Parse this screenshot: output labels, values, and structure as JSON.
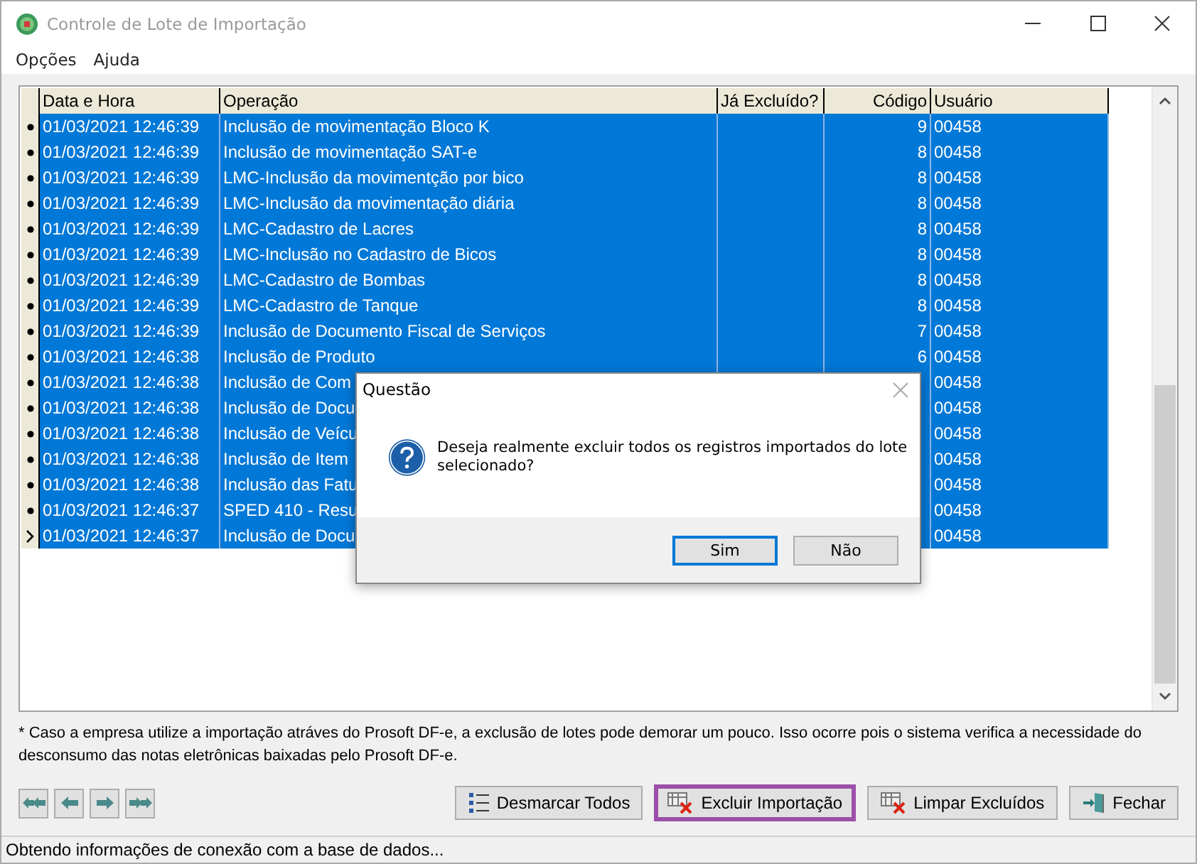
{
  "window": {
    "title": "Controle de Lote de Importação"
  },
  "menu": [
    "Opções",
    "Ajuda"
  ],
  "table": {
    "columns": [
      "Data e Hora",
      "Operação",
      "Já Excluído?",
      "Código",
      "Usuário"
    ],
    "rows": [
      {
        "current": false,
        "selected": true,
        "cells": [
          "01/03/2021 12:46:39",
          "Inclusão de movimentação Bloco K",
          "",
          "9",
          "00458"
        ]
      },
      {
        "current": false,
        "selected": true,
        "cells": [
          "01/03/2021 12:46:39",
          "Inclusão de movimentação SAT-e",
          "",
          "8",
          "00458"
        ]
      },
      {
        "current": false,
        "selected": true,
        "cells": [
          "01/03/2021 12:46:39",
          "LMC-Inclusão da movimentção por bico",
          "",
          "8",
          "00458"
        ]
      },
      {
        "current": false,
        "selected": true,
        "cells": [
          "01/03/2021 12:46:39",
          "LMC-Inclusão da movimentação diária",
          "",
          "8",
          "00458"
        ]
      },
      {
        "current": false,
        "selected": true,
        "cells": [
          "01/03/2021 12:46:39",
          "LMC-Cadastro de Lacres",
          "",
          "8",
          "00458"
        ]
      },
      {
        "current": false,
        "selected": true,
        "cells": [
          "01/03/2021 12:46:39",
          "LMC-Inclusão no Cadastro de Bicos",
          "",
          "8",
          "00458"
        ]
      },
      {
        "current": false,
        "selected": true,
        "cells": [
          "01/03/2021 12:46:39",
          "LMC-Cadastro de Bombas",
          "",
          "8",
          "00458"
        ]
      },
      {
        "current": false,
        "selected": true,
        "cells": [
          "01/03/2021 12:46:39",
          "LMC-Cadastro de Tanque",
          "",
          "8",
          "00458"
        ]
      },
      {
        "current": false,
        "selected": true,
        "cells": [
          "01/03/2021 12:46:39",
          "Inclusão de Documento Fiscal de Serviços",
          "",
          "7",
          "00458"
        ]
      },
      {
        "current": false,
        "selected": true,
        "cells": [
          "01/03/2021 12:46:38",
          "Inclusão de Produto",
          "",
          "6",
          "00458"
        ]
      },
      {
        "current": false,
        "selected": true,
        "cells": [
          "01/03/2021 12:46:38",
          "Inclusão de Com",
          "",
          "",
          "00458"
        ]
      },
      {
        "current": false,
        "selected": true,
        "cells": [
          "01/03/2021 12:46:38",
          "Inclusão de Docu",
          "",
          "",
          "00458"
        ]
      },
      {
        "current": false,
        "selected": true,
        "cells": [
          "01/03/2021 12:46:38",
          "Inclusão de Veícu",
          "",
          "",
          "00458"
        ]
      },
      {
        "current": false,
        "selected": true,
        "cells": [
          "01/03/2021 12:46:38",
          "Inclusão de Item",
          "",
          "",
          "00458"
        ]
      },
      {
        "current": false,
        "selected": true,
        "cells": [
          "01/03/2021 12:46:38",
          "Inclusão das Fatu",
          "",
          "",
          "00458"
        ]
      },
      {
        "current": false,
        "selected": true,
        "cells": [
          "01/03/2021 12:46:37",
          "SPED 410 - Resu",
          "",
          "",
          "00458"
        ]
      },
      {
        "current": true,
        "selected": true,
        "cells": [
          "01/03/2021 12:46:37",
          "Inclusão de Docu",
          "",
          "",
          "00458"
        ]
      }
    ]
  },
  "note": "* Caso a empresa utilize a importação atráves do Prosoft DF-e, a exclusão de lotes pode demorar um pouco. Isso ocorre pois o sistema verifica a necessidade do desconsumo das notas eletrônicas baixadas pelo  Prosoft DF-e.",
  "navigation": [
    {
      "kind": "first"
    },
    {
      "kind": "previous"
    },
    {
      "kind": "next"
    },
    {
      "kind": "last"
    }
  ],
  "buttons": [
    {
      "kind": "list",
      "label": "Desmarcar Todos",
      "focused": false
    },
    {
      "kind": "delete",
      "label": "Excluir Importação",
      "focused": true
    },
    {
      "kind": "delete",
      "label": "Limpar Excluídos",
      "focused": false
    },
    {
      "kind": "exit",
      "label": "Fechar",
      "focused": false
    }
  ],
  "status_bar": "Obtendo informações de conexão com a base de dados...",
  "dialog": {
    "title": "Questão",
    "message": "Deseja realmente excluir todos os registros importados do lote selecionado?",
    "buttons": [
      {
        "label": "Sim",
        "focused": true
      },
      {
        "label": "Não",
        "focused": false
      }
    ]
  }
}
